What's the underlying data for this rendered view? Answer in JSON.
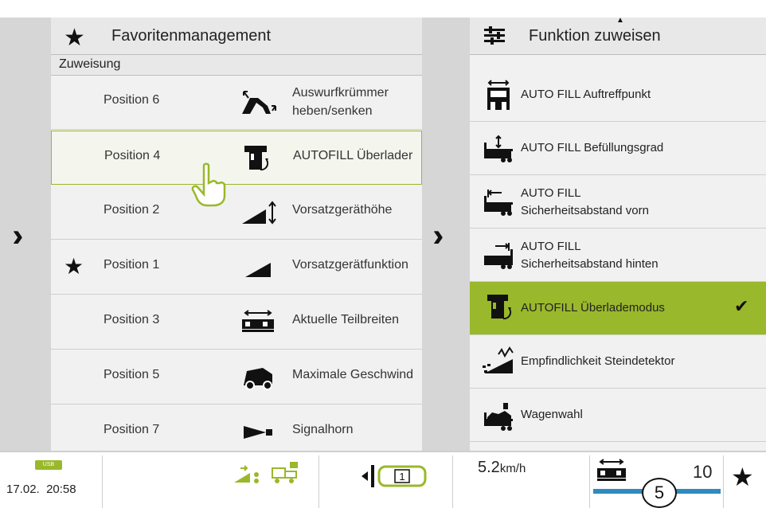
{
  "favorites": {
    "title": "Favoritenmanagement",
    "subheader": "Zuweisung",
    "rows": [
      {
        "position": "Position 6",
        "function_line1": "Auswurfkrümmer",
        "function_line2": "heben/senken",
        "icon": "spout-icon",
        "starred": false,
        "selected": false
      },
      {
        "position": "Position 4",
        "function": "AUTOFILL Überlader",
        "icon": "autofill-overload-icon",
        "starred": false,
        "selected": true
      },
      {
        "position": "Position 2",
        "function": "Vorsatzgeräthöhe",
        "icon": "header-height-icon",
        "starred": false,
        "selected": false
      },
      {
        "position": "Position 1",
        "function": "Vorsatzgerätfunktion",
        "icon": "header-function-icon",
        "starred": true,
        "selected": false
      },
      {
        "position": "Position 3",
        "function": "Aktuelle Teilbreiten",
        "icon": "section-width-icon",
        "starred": false,
        "selected": false
      },
      {
        "position": "Position 5",
        "function": "Maximale Geschwind",
        "icon": "max-speed-icon",
        "starred": false,
        "selected": false
      },
      {
        "position": "Position 7",
        "function": "Signalhorn",
        "icon": "horn-icon",
        "starred": false,
        "selected": false
      }
    ]
  },
  "assign": {
    "title": "Funktion zuweisen",
    "options": [
      {
        "label": "AUTO FILL Auftreffpunkt",
        "icon": "impact-point-icon",
        "active": false
      },
      {
        "label": "AUTO FILL Befüllungsgrad",
        "icon": "fill-level-icon",
        "active": false
      },
      {
        "label_line1": "AUTO FILL",
        "label_line2": "Sicherheitsabstand vorn",
        "icon": "front-distance-icon",
        "active": false
      },
      {
        "label_line1": "AUTO FILL",
        "label_line2": "Sicherheitsabstand hinten",
        "icon": "rear-distance-icon",
        "active": false
      },
      {
        "label": "AUTOFILL Überlademodus",
        "icon": "overload-mode-icon",
        "active": true
      },
      {
        "label": "Empfindlichkeit Steindetektor",
        "icon": "stone-detector-icon",
        "active": false
      },
      {
        "label": "Wagenwahl",
        "icon": "wagon-select-icon",
        "active": false
      }
    ]
  },
  "statusbar": {
    "usb_label": "USB",
    "date": "17.02.",
    "time": "20:58",
    "track_label": "1",
    "speed_value": "5.2",
    "speed_unit": "km/h",
    "section_count": "10",
    "callout_number": "5"
  },
  "colors": {
    "accent_green": "#9ab82b",
    "bar_blue": "#2e8bbf"
  }
}
